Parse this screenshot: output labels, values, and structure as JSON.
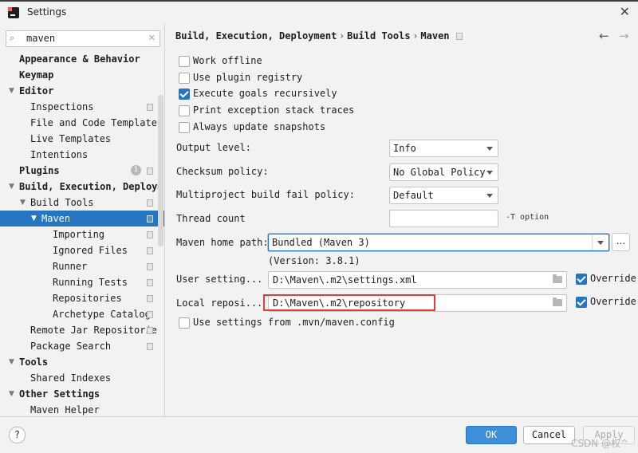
{
  "window": {
    "title": "Settings"
  },
  "search": {
    "value": "maven"
  },
  "sidebar": {
    "items": [
      {
        "label": "Appearance & Behavior",
        "bold": true,
        "level": 0,
        "arrow": ""
      },
      {
        "label": "Keymap",
        "bold": true,
        "level": 0,
        "arrow": ""
      },
      {
        "label": "Editor",
        "bold": true,
        "level": 0,
        "arrow": "expanded"
      },
      {
        "label": "Inspections",
        "bold": false,
        "level": 1,
        "project": true
      },
      {
        "label": "File and Code Templates",
        "bold": false,
        "level": 1
      },
      {
        "label": "Live Templates",
        "bold": false,
        "level": 1
      },
      {
        "label": "Intentions",
        "bold": false,
        "level": 1
      },
      {
        "label": "Plugins",
        "bold": true,
        "level": 0,
        "badge": "1",
        "project": true
      },
      {
        "label": "Build, Execution, Deploym",
        "bold": true,
        "level": 0,
        "arrow": "expanded"
      },
      {
        "label": "Build Tools",
        "bold": false,
        "level": 1,
        "arrow": "expanded",
        "project": true
      },
      {
        "label": "Maven",
        "bold": false,
        "level": 2,
        "arrow": "expanded",
        "project": true,
        "selected": true
      },
      {
        "label": "Importing",
        "bold": false,
        "level": 3,
        "project": true
      },
      {
        "label": "Ignored Files",
        "bold": false,
        "level": 3,
        "project": true
      },
      {
        "label": "Runner",
        "bold": false,
        "level": 3,
        "project": true
      },
      {
        "label": "Running Tests",
        "bold": false,
        "level": 3,
        "project": true
      },
      {
        "label": "Repositories",
        "bold": false,
        "level": 3,
        "project": true
      },
      {
        "label": "Archetype Catalog",
        "bold": false,
        "level": 3,
        "project": true
      },
      {
        "label": "Remote Jar Repositorie",
        "bold": false,
        "level": 1,
        "project": true
      },
      {
        "label": "Package Search",
        "bold": false,
        "level": 1,
        "project": true
      },
      {
        "label": "Tools",
        "bold": true,
        "level": 0,
        "arrow": "expanded"
      },
      {
        "label": "Shared Indexes",
        "bold": false,
        "level": 1
      },
      {
        "label": "Other Settings",
        "bold": true,
        "level": 0,
        "arrow": "expanded"
      },
      {
        "label": "Maven Helper",
        "bold": false,
        "level": 1
      }
    ]
  },
  "breadcrumb": {
    "parts": [
      "Build, Execution, Deployment",
      "Build Tools",
      "Maven"
    ],
    "separator": "›"
  },
  "nav": {
    "back": "←",
    "forward": "→"
  },
  "checkboxes": [
    {
      "label": "Work offline",
      "checked": false
    },
    {
      "label": "Use plugin registry",
      "checked": false
    },
    {
      "label": "Execute goals recursively",
      "checked": true
    },
    {
      "label": "Print exception stack traces",
      "checked": false
    },
    {
      "label": "Always update snapshots",
      "checked": false
    }
  ],
  "output_level": {
    "label": "Output level:",
    "value": "Info"
  },
  "checksum_policy": {
    "label": "Checksum policy:",
    "value": "No Global Policy"
  },
  "multiproject": {
    "label": "Multiproject build fail policy:",
    "value": "Default"
  },
  "thread_count": {
    "label": "Thread count",
    "value": "",
    "hint": "-T option"
  },
  "maven_home": {
    "label": "Maven home path:",
    "value": "Bundled (Maven 3)",
    "browse": "...",
    "version": "(Version: 3.8.1)"
  },
  "user_settings": {
    "label": "User setting...",
    "value": "D:\\Maven\\.m2\\settings.xml",
    "override_label": "Override",
    "override_checked": true
  },
  "local_repo": {
    "label": "Local reposi...",
    "value": "D:\\Maven\\.m2\\repository",
    "override_label": "Override",
    "override_checked": true
  },
  "mvn_config": {
    "label": "Use settings from .mvn/maven.config",
    "checked": false
  },
  "buttons": {
    "help": "?",
    "ok": "OK",
    "cancel": "Cancel",
    "apply": "Apply"
  },
  "watermark": "CSDN @权^",
  "colors": {
    "accent": "#2675bf",
    "ok_button": "#3d8fd8",
    "highlight_box": "#e03c3c"
  }
}
